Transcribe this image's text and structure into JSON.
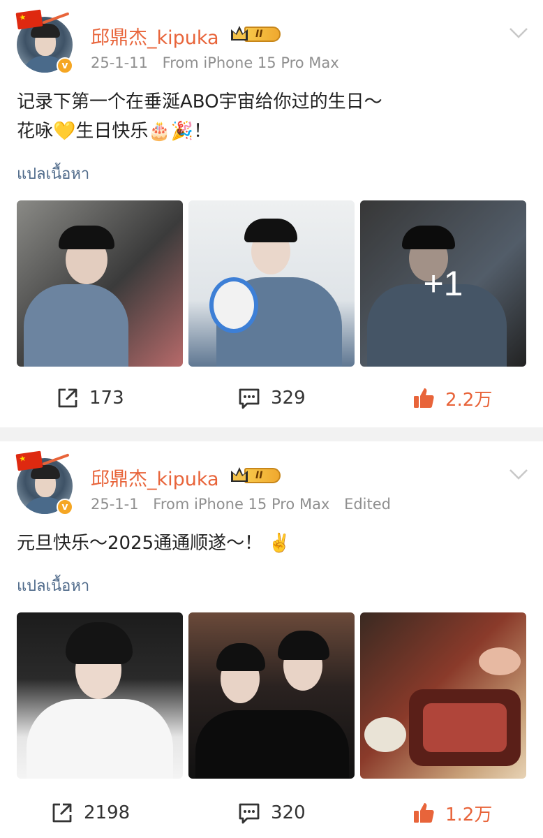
{
  "posts": [
    {
      "username": "邱鼎杰_kipuka",
      "rank": "II",
      "date": "25-1-11",
      "source": "From iPhone 15 Pro Max",
      "edited": "",
      "content_lines": [
        "记录下第一个在垂涎ABO宇宙给你过的生日～",
        "花咏💛生日快乐🎂🎉！"
      ],
      "translate_label": "แปลเนื้อหา",
      "extra_images_label": "+1",
      "reposts": "173",
      "comments": "329",
      "likes": "2.2万"
    },
    {
      "username": "邱鼎杰_kipuka",
      "rank": "II",
      "date": "25-1-1",
      "source": "From iPhone 15 Pro Max",
      "edited": "Edited",
      "content_lines": [
        "元旦快乐～2025通通顺遂～！ ✌️"
      ],
      "translate_label": "แปลเนื้อหา",
      "reposts": "2198",
      "comments": "320",
      "likes": "1.2万"
    }
  ],
  "colors": {
    "accent": "#e8643a",
    "meta": "#8f8f8f",
    "translate": "#4f6a8a",
    "verified": "#f5a623"
  },
  "icons": [
    "repost-icon",
    "comment-icon",
    "like-icon",
    "chevron-down-icon",
    "verified-icon",
    "crown-icon",
    "flag-icon"
  ]
}
